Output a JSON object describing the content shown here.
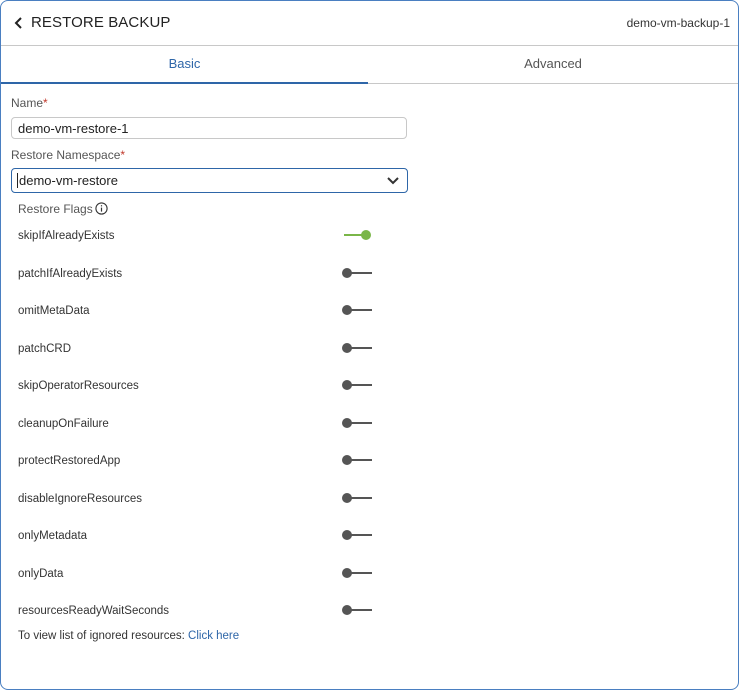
{
  "header": {
    "title": "RESTORE BACKUP",
    "backup_name": "demo-vm-backup-1"
  },
  "tabs": [
    {
      "label": "Basic",
      "active": true
    },
    {
      "label": "Advanced",
      "active": false
    }
  ],
  "form": {
    "name_label": "Name",
    "name_value": "demo-vm-restore-1",
    "namespace_label": "Restore Namespace",
    "namespace_value": "demo-vm-restore",
    "required_mark": "*"
  },
  "flags_title": "Restore Flags",
  "flags": [
    {
      "label": "skipIfAlreadyExists",
      "on": true
    },
    {
      "label": "patchIfAlreadyExists",
      "on": false
    },
    {
      "label": "omitMetaData",
      "on": false
    },
    {
      "label": "patchCRD",
      "on": false
    },
    {
      "label": "skipOperatorResources",
      "on": false
    },
    {
      "label": "cleanupOnFailure",
      "on": false
    },
    {
      "label": "protectRestoredApp",
      "on": false
    },
    {
      "label": "disableIgnoreResources",
      "on": false
    },
    {
      "label": "onlyMetadata",
      "on": false
    },
    {
      "label": "onlyData",
      "on": false
    },
    {
      "label": "resourcesReadyWaitSeconds",
      "on": false
    }
  ],
  "note": {
    "text": "To view list of ignored resources: ",
    "link": "Click here"
  },
  "colors": {
    "accent": "#2e66a8",
    "toggle_on": "#7ab648",
    "toggle_off": "#555555",
    "required": "#c0392b"
  }
}
